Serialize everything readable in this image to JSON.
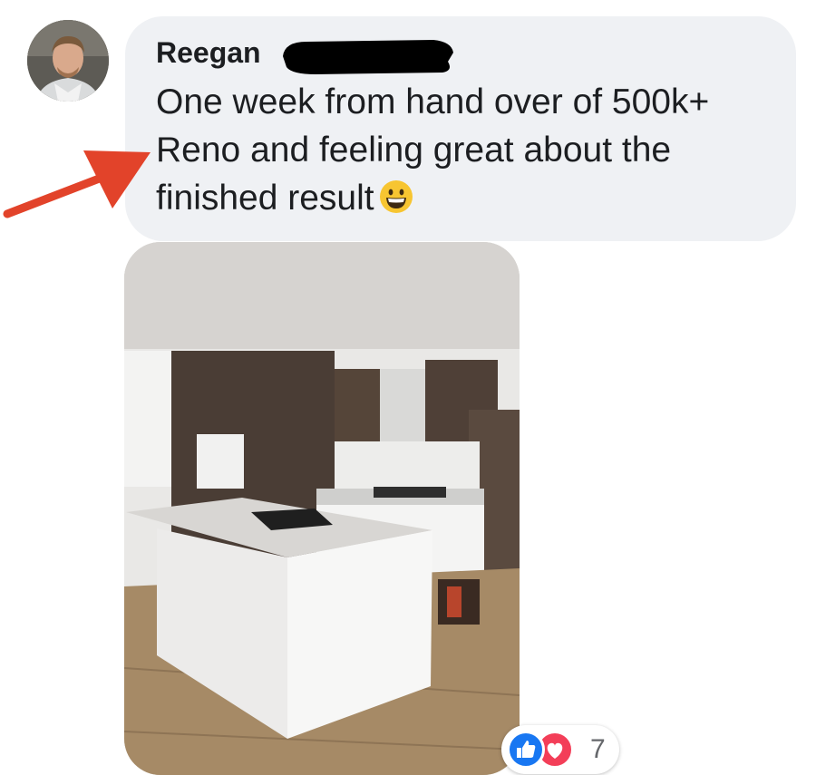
{
  "comment": {
    "author_name": "Reegan",
    "text": "One week from hand over of 500k+ Reno and feeling great about the finished result",
    "emoji": "grinning-face-emoji"
  },
  "reactions": {
    "types": [
      "like",
      "love"
    ],
    "count": "7"
  },
  "colors": {
    "bubble_bg": "#eff1f4",
    "text": "#1c1e21",
    "arrow": "#e2432a",
    "like": "#1877f2",
    "love": "#f33e58"
  }
}
